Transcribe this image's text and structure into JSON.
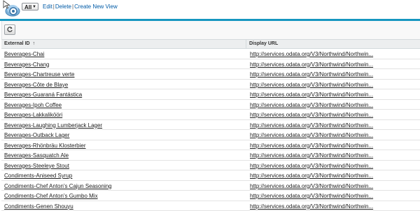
{
  "toolbar": {
    "view_selected": "All",
    "links": {
      "edit": "Edit",
      "delete": "Delete",
      "create_new_view": "Create New View"
    },
    "separator": "|"
  },
  "table": {
    "columns": [
      "External ID",
      "Display URL"
    ],
    "sort_indicator": "↑",
    "rows": [
      {
        "external_id": "Beverages-Chai",
        "display_url": "http://services.odata.org/V3/Northwind/Northwin..."
      },
      {
        "external_id": "Beverages-Chang",
        "display_url": "http://services.odata.org/V3/Northwind/Northwin..."
      },
      {
        "external_id": "Beverages-Chartreuse verte",
        "display_url": "http://services.odata.org/V3/Northwind/Northwin..."
      },
      {
        "external_id": "Beverages-Côte de Blaye",
        "display_url": "http://services.odata.org/V3/Northwind/Northwin..."
      },
      {
        "external_id": "Beverages-Guaraná Fantástica",
        "display_url": "http://services.odata.org/V3/Northwind/Northwin..."
      },
      {
        "external_id": "Beverages-Ipoh Coffee",
        "display_url": "http://services.odata.org/V3/Northwind/Northwin..."
      },
      {
        "external_id": "Beverages-Lakkalikööri",
        "display_url": "http://services.odata.org/V3/Northwind/Northwin..."
      },
      {
        "external_id": "Beverages-Laughing Lumberjack Lager",
        "display_url": "http://services.odata.org/V3/Northwind/Northwin..."
      },
      {
        "external_id": "Beverages-Outback Lager",
        "display_url": "http://services.odata.org/V3/Northwind/Northwin..."
      },
      {
        "external_id": "Beverages-Rhönbräu Klosterbier",
        "display_url": "http://services.odata.org/V3/Northwind/Northwin..."
      },
      {
        "external_id": "Beverages-Sasquatch Ale",
        "display_url": "http://services.odata.org/V3/Northwind/Northwin..."
      },
      {
        "external_id": "Beverages-Steeleye Stout",
        "display_url": "http://services.odata.org/V3/Northwind/Northwin..."
      },
      {
        "external_id": "Condiments-Aniseed Syrup",
        "display_url": "http://services.odata.org/V3/Northwind/Northwin..."
      },
      {
        "external_id": "Condiments-Chef Anton's Cajun Seasoning",
        "display_url": "http://services.odata.org/V3/Northwind/Northwin..."
      },
      {
        "external_id": "Condiments-Chef Anton's Gumbo Mix",
        "display_url": "http://services.odata.org/V3/Northwind/Northwin..."
      },
      {
        "external_id": "Condiments-Genen Shouyu",
        "display_url": "http://services.odata.org/V3/Northwind/Northwin..."
      }
    ]
  },
  "icons": {
    "logo": "external-data-cloud-icon",
    "refresh": "refresh-icon"
  },
  "colors": {
    "link": "#015ba7",
    "divider": "#1797c0",
    "header_bg": "#eceeef"
  }
}
